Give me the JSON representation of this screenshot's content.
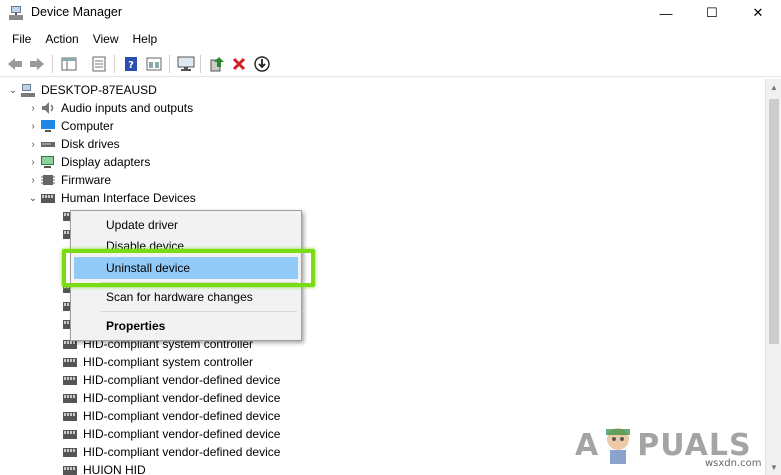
{
  "window": {
    "title": "Device Manager"
  },
  "window_controls": {
    "minimize": "—",
    "maximize": "☐",
    "close": "✕"
  },
  "menu": [
    "File",
    "Action",
    "View",
    "Help"
  ],
  "toolbar": {
    "buttons": [
      "back-arrow-icon",
      "forward-arrow-icon",
      "console-tree-icon",
      "properties-icon",
      "help-icon",
      "view-icon",
      "monitor-icon",
      "update-driver-icon",
      "uninstall-icon",
      "download-icon"
    ],
    "colors": {
      "uninstall": "#d22020",
      "update": "#2a8a2a",
      "help": "#2b4fb0"
    }
  },
  "tree": {
    "root": "DESKTOP-87EAUSD",
    "categories": [
      {
        "label": "Audio inputs and outputs",
        "icon": "speaker-icon"
      },
      {
        "label": "Computer",
        "icon": "computer-icon"
      },
      {
        "label": "Disk drives",
        "icon": "disk-icon"
      },
      {
        "label": "Display adapters",
        "icon": "display-adapter-icon"
      },
      {
        "label": "Firmware",
        "icon": "chip-icon"
      },
      {
        "label": "Human Interface Devices",
        "icon": "hid-icon"
      }
    ],
    "hid_children": [
      "HID-compliant system controller",
      "HID-compliant system controller",
      "HID-compliant vendor-defined device",
      "HID-compliant vendor-defined device",
      "HID-compliant vendor-defined device",
      "HID-compliant vendor-defined device",
      "HID-compliant vendor-defined device",
      "HUION HID"
    ]
  },
  "context_menu": {
    "update_driver": "Update driver",
    "disable_device": "Disable device",
    "uninstall_device": "Uninstall device",
    "scan": "Scan for hardware changes",
    "properties": "Properties",
    "highlight_color": "#91c9f7",
    "callout_color": "#7cdb15"
  },
  "watermark": {
    "brand_left": "A",
    "brand_right": "PUALS",
    "site": "wsxdn.com"
  }
}
